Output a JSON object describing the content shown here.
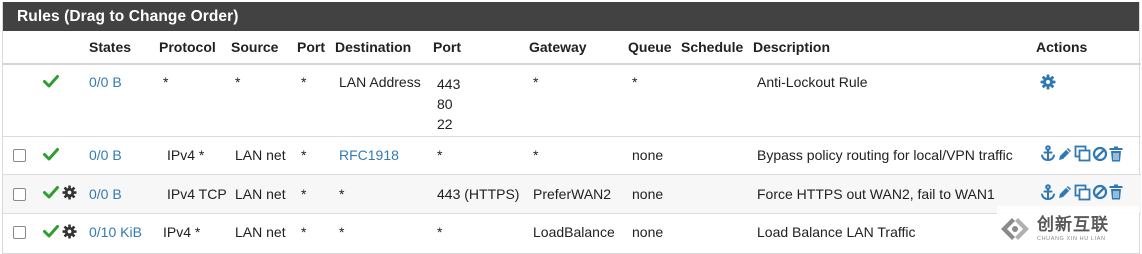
{
  "panel": {
    "title": "Rules (Drag to Change Order)"
  },
  "columns": {
    "states": "States",
    "protocol": "Protocol",
    "source": "Source",
    "port": "Port",
    "destination": "Destination",
    "dest_port": "Port",
    "gateway": "Gateway",
    "queue": "Queue",
    "schedule": "Schedule",
    "description": "Description",
    "actions": "Actions"
  },
  "rules": [
    {
      "states": "0/0 B",
      "protocol": "*",
      "source": "*",
      "port": "*",
      "destination": "LAN Address",
      "dest_ports": [
        "443",
        "80",
        "22"
      ],
      "gateway": "*",
      "queue": "*",
      "schedule": "",
      "description": "Anti-Lockout Rule"
    },
    {
      "states": "0/0 B",
      "protocol": "IPv4 *",
      "source": "LAN net",
      "port": "*",
      "destination": "RFC1918",
      "dest_port": "*",
      "gateway": "*",
      "queue": "none",
      "schedule": "",
      "description": "Bypass policy routing for local/VPN traffic"
    },
    {
      "states": "0/0 B",
      "protocol": "IPv4 TCP",
      "source": "LAN net",
      "port": "*",
      "destination": "*",
      "dest_port": "443 (HTTPS)",
      "gateway": "PreferWAN2",
      "queue": "none",
      "schedule": "",
      "description": "Force HTTPS out WAN2, fail to WAN1"
    },
    {
      "states": "0/10 KiB",
      "protocol": "IPv4 *",
      "source": "LAN net",
      "port": "*",
      "destination": "*",
      "dest_port": "*",
      "gateway": "LoadBalance",
      "queue": "none",
      "schedule": "",
      "description": "Load Balance LAN Traffic"
    }
  ],
  "watermark": {
    "main": "创新互联",
    "sub": "CHUANG XIN HU LIAN"
  },
  "colors": {
    "heading_bg": "#424242",
    "link": "#337ab7",
    "check_green": "#2e9e2e",
    "action_blue": "#2f78b4"
  }
}
